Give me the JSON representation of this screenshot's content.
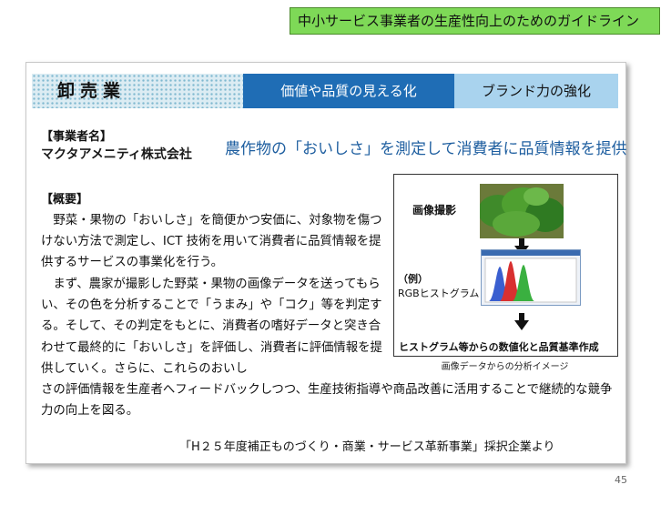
{
  "banner": {
    "title": "中小サービス事業者の生産性向上のためのガイドライン"
  },
  "header": {
    "industry": "卸売業",
    "tab1": "価値や品質の見える化",
    "tab2": "ブランド力の強化"
  },
  "company": {
    "label": "【事業者名】",
    "name": "マクタアメニティ株式会社"
  },
  "headline": "農作物の「おいしさ」を測定して消費者に品質情報を提供",
  "overview": {
    "label": "【概要】",
    "para1": "　野菜・果物の「おいしさ」を簡便かつ安価に、対象物を傷つけない方法で測定し、ICT 技術を用いて消費者に品質情報を提供するサービスの事業化を行う。",
    "para2": "　まず、農家が撮影した野菜・果物の画像データを送ってもらい、その色を分析することで「うまみ」や「コク」等を判定する。そして、その判定をもとに、消費者の嗜好データと突き合わせて最終的に「おいしさ」を評価し、消費者に評価情報を提供していく。さらに、これらのおいし",
    "para3": "さの評価情報を生産者へフィードバックしつつ、生産技術指導や商品改善に活用することで継続的な競争力の向上を図る。"
  },
  "figure": {
    "step1": "画像撮影",
    "example": "（例）",
    "rgb": "RGBヒストグラム",
    "bottom": "ヒストグラム等からの数値化と品質基準作成",
    "caption": "画像データからの分析イメージ"
  },
  "source": "「H２５年度補正ものづくり・商業・サービス革新事業」採択企業より",
  "page_number": "45"
}
